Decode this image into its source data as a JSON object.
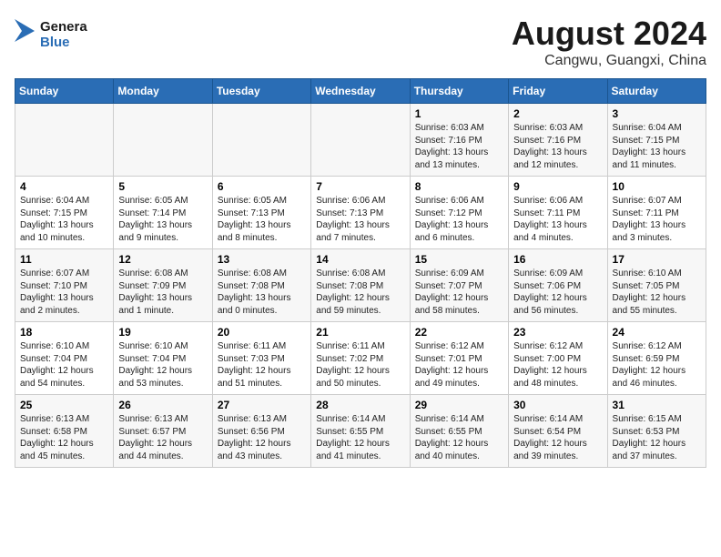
{
  "header": {
    "logo_line1": "General",
    "logo_line2": "Blue",
    "month": "August 2024",
    "location": "Cangwu, Guangxi, China"
  },
  "weekdays": [
    "Sunday",
    "Monday",
    "Tuesday",
    "Wednesday",
    "Thursday",
    "Friday",
    "Saturday"
  ],
  "weeks": [
    [
      {
        "day": "",
        "info": ""
      },
      {
        "day": "",
        "info": ""
      },
      {
        "day": "",
        "info": ""
      },
      {
        "day": "",
        "info": ""
      },
      {
        "day": "1",
        "info": "Sunrise: 6:03 AM\nSunset: 7:16 PM\nDaylight: 13 hours\nand 13 minutes."
      },
      {
        "day": "2",
        "info": "Sunrise: 6:03 AM\nSunset: 7:16 PM\nDaylight: 13 hours\nand 12 minutes."
      },
      {
        "day": "3",
        "info": "Sunrise: 6:04 AM\nSunset: 7:15 PM\nDaylight: 13 hours\nand 11 minutes."
      }
    ],
    [
      {
        "day": "4",
        "info": "Sunrise: 6:04 AM\nSunset: 7:15 PM\nDaylight: 13 hours\nand 10 minutes."
      },
      {
        "day": "5",
        "info": "Sunrise: 6:05 AM\nSunset: 7:14 PM\nDaylight: 13 hours\nand 9 minutes."
      },
      {
        "day": "6",
        "info": "Sunrise: 6:05 AM\nSunset: 7:13 PM\nDaylight: 13 hours\nand 8 minutes."
      },
      {
        "day": "7",
        "info": "Sunrise: 6:06 AM\nSunset: 7:13 PM\nDaylight: 13 hours\nand 7 minutes."
      },
      {
        "day": "8",
        "info": "Sunrise: 6:06 AM\nSunset: 7:12 PM\nDaylight: 13 hours\nand 6 minutes."
      },
      {
        "day": "9",
        "info": "Sunrise: 6:06 AM\nSunset: 7:11 PM\nDaylight: 13 hours\nand 4 minutes."
      },
      {
        "day": "10",
        "info": "Sunrise: 6:07 AM\nSunset: 7:11 PM\nDaylight: 13 hours\nand 3 minutes."
      }
    ],
    [
      {
        "day": "11",
        "info": "Sunrise: 6:07 AM\nSunset: 7:10 PM\nDaylight: 13 hours\nand 2 minutes."
      },
      {
        "day": "12",
        "info": "Sunrise: 6:08 AM\nSunset: 7:09 PM\nDaylight: 13 hours\nand 1 minute."
      },
      {
        "day": "13",
        "info": "Sunrise: 6:08 AM\nSunset: 7:08 PM\nDaylight: 13 hours\nand 0 minutes."
      },
      {
        "day": "14",
        "info": "Sunrise: 6:08 AM\nSunset: 7:08 PM\nDaylight: 12 hours\nand 59 minutes."
      },
      {
        "day": "15",
        "info": "Sunrise: 6:09 AM\nSunset: 7:07 PM\nDaylight: 12 hours\nand 58 minutes."
      },
      {
        "day": "16",
        "info": "Sunrise: 6:09 AM\nSunset: 7:06 PM\nDaylight: 12 hours\nand 56 minutes."
      },
      {
        "day": "17",
        "info": "Sunrise: 6:10 AM\nSunset: 7:05 PM\nDaylight: 12 hours\nand 55 minutes."
      }
    ],
    [
      {
        "day": "18",
        "info": "Sunrise: 6:10 AM\nSunset: 7:04 PM\nDaylight: 12 hours\nand 54 minutes."
      },
      {
        "day": "19",
        "info": "Sunrise: 6:10 AM\nSunset: 7:04 PM\nDaylight: 12 hours\nand 53 minutes."
      },
      {
        "day": "20",
        "info": "Sunrise: 6:11 AM\nSunset: 7:03 PM\nDaylight: 12 hours\nand 51 minutes."
      },
      {
        "day": "21",
        "info": "Sunrise: 6:11 AM\nSunset: 7:02 PM\nDaylight: 12 hours\nand 50 minutes."
      },
      {
        "day": "22",
        "info": "Sunrise: 6:12 AM\nSunset: 7:01 PM\nDaylight: 12 hours\nand 49 minutes."
      },
      {
        "day": "23",
        "info": "Sunrise: 6:12 AM\nSunset: 7:00 PM\nDaylight: 12 hours\nand 48 minutes."
      },
      {
        "day": "24",
        "info": "Sunrise: 6:12 AM\nSunset: 6:59 PM\nDaylight: 12 hours\nand 46 minutes."
      }
    ],
    [
      {
        "day": "25",
        "info": "Sunrise: 6:13 AM\nSunset: 6:58 PM\nDaylight: 12 hours\nand 45 minutes."
      },
      {
        "day": "26",
        "info": "Sunrise: 6:13 AM\nSunset: 6:57 PM\nDaylight: 12 hours\nand 44 minutes."
      },
      {
        "day": "27",
        "info": "Sunrise: 6:13 AM\nSunset: 6:56 PM\nDaylight: 12 hours\nand 43 minutes."
      },
      {
        "day": "28",
        "info": "Sunrise: 6:14 AM\nSunset: 6:55 PM\nDaylight: 12 hours\nand 41 minutes."
      },
      {
        "day": "29",
        "info": "Sunrise: 6:14 AM\nSunset: 6:55 PM\nDaylight: 12 hours\nand 40 minutes."
      },
      {
        "day": "30",
        "info": "Sunrise: 6:14 AM\nSunset: 6:54 PM\nDaylight: 12 hours\nand 39 minutes."
      },
      {
        "day": "31",
        "info": "Sunrise: 6:15 AM\nSunset: 6:53 PM\nDaylight: 12 hours\nand 37 minutes."
      }
    ]
  ]
}
